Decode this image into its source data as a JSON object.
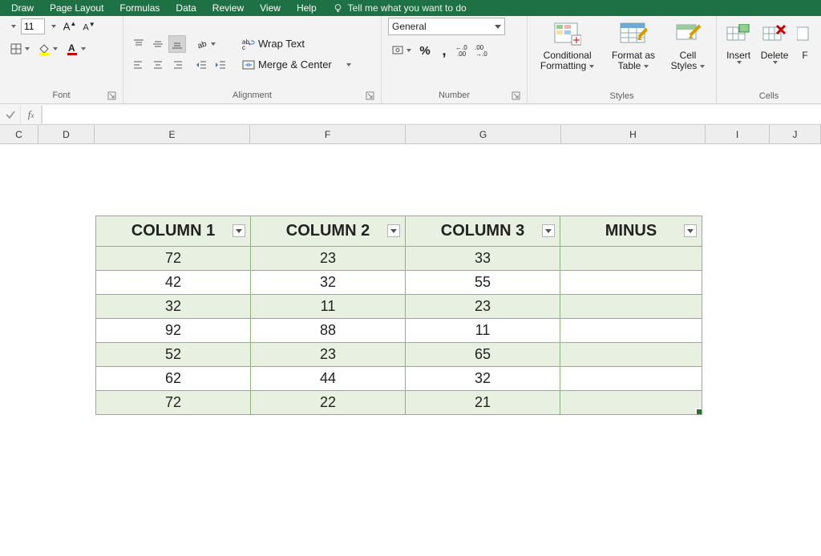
{
  "menu": {
    "items": [
      "Draw",
      "Page Layout",
      "Formulas",
      "Data",
      "Review",
      "View",
      "Help"
    ],
    "tellme": "Tell me what you want to do"
  },
  "ribbon": {
    "font": {
      "size": "11",
      "group_label": "Font"
    },
    "alignment": {
      "wrap": "Wrap Text",
      "merge": "Merge & Center",
      "group_label": "Alignment"
    },
    "number": {
      "format": "General",
      "group_label": "Number"
    },
    "styles": {
      "cond": "Conditional",
      "condb": "Formatting",
      "fmt": "Format as",
      "fmtb": "Table",
      "cell": "Cell",
      "cellb": "Styles",
      "group_label": "Styles"
    },
    "cells": {
      "insert": "Insert",
      "delete": "Delete",
      "fo": "F",
      "group_label": "Cells"
    }
  },
  "columns": [
    "C",
    "D",
    "E",
    "F",
    "G",
    "H",
    "I",
    "J"
  ],
  "table": {
    "headers": [
      "COLUMN 1",
      "COLUMN 2",
      "COLUMN 3",
      "MINUS"
    ],
    "rows": [
      [
        "72",
        "23",
        "33",
        ""
      ],
      [
        "42",
        "32",
        "55",
        ""
      ],
      [
        "32",
        "11",
        "23",
        ""
      ],
      [
        "92",
        "88",
        "11",
        ""
      ],
      [
        "52",
        "23",
        "65",
        ""
      ],
      [
        "62",
        "44",
        "32",
        ""
      ],
      [
        "72",
        "22",
        "21",
        ""
      ]
    ]
  }
}
